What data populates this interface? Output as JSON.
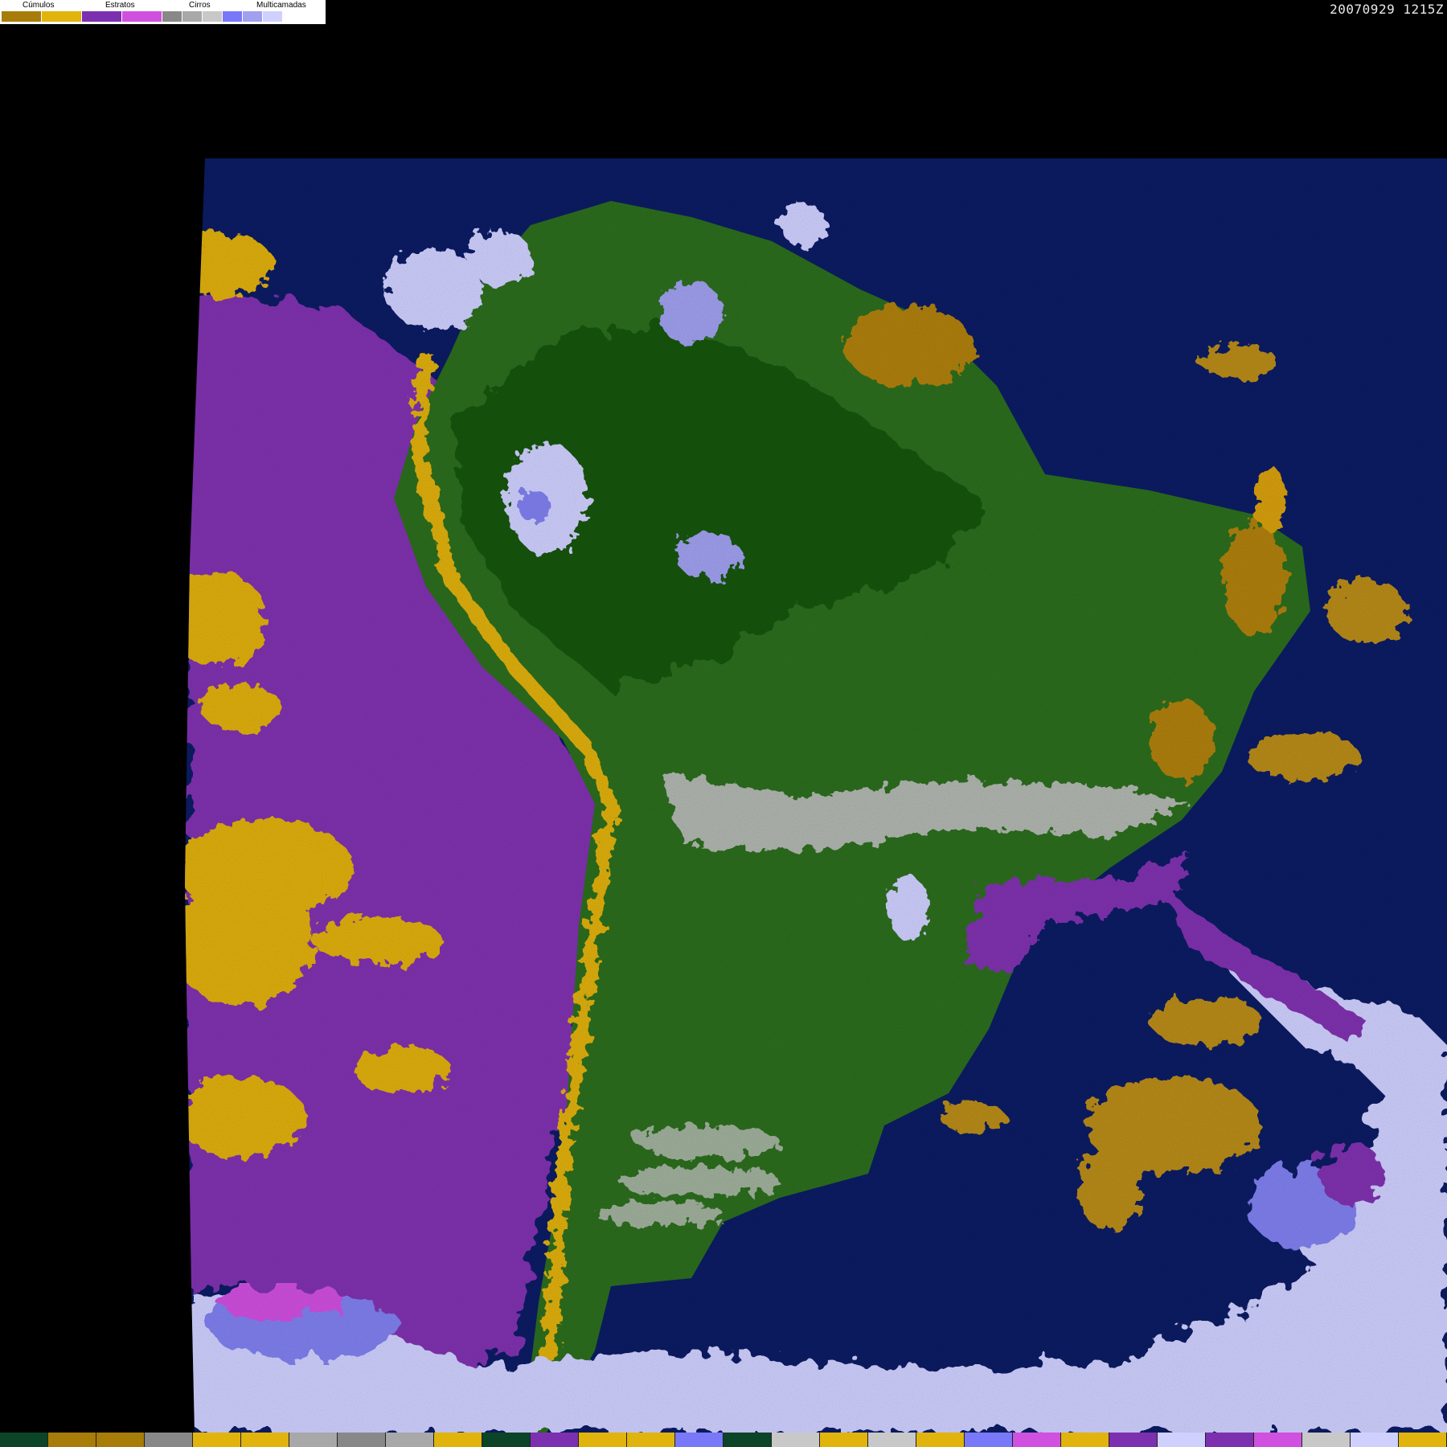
{
  "legend": {
    "categories": [
      {
        "label": "Cúmulos",
        "colors": [
          "#a87c08",
          "#e0b40c"
        ]
      },
      {
        "label": "Estratos",
        "colors": [
          "#7c30b0",
          "#d050e0"
        ]
      },
      {
        "label": "Cirros",
        "colors": [
          "#888888",
          "#a8a8a8",
          "#c8c8c8"
        ]
      },
      {
        "label": "Multicamadas",
        "colors": [
          "#7878f8",
          "#a0a0f0",
          "#d0d0ff"
        ]
      }
    ]
  },
  "timestamp": "20070929 1215Z",
  "colors": {
    "ocean": "#0c1c64",
    "land": "#2c6e1e",
    "forest": "#1c5a14",
    "stratus_ocean": "#8030b0",
    "cumulus": "#e0b010",
    "cumulus_dark": "#a87c08",
    "multilayer": "#d0d0ff",
    "multilayer_mid": "#8080f0",
    "cirrus": "#c0c0c0",
    "background": "#000000"
  },
  "bottom_strip": [
    "#0c4428",
    "#a87c08",
    "#a87c08",
    "#888888",
    "#e0b40c",
    "#e0b40c",
    "#a8a8a8",
    "#888888",
    "#a8a8a8",
    "#e0b40c",
    "#0c4428",
    "#7c30b0",
    "#e0b40c",
    "#e0b40c",
    "#7878f8",
    "#0c4428",
    "#c8c8c8",
    "#e0b40c",
    "#c8c8c8",
    "#e0b40c",
    "#7878f8",
    "#d050e0",
    "#e0b40c",
    "#7c30b0",
    "#d0d0ff",
    "#7c30b0",
    "#d050e0",
    "#c8c8c8",
    "#d0d0ff",
    "#e0b40c"
  ]
}
